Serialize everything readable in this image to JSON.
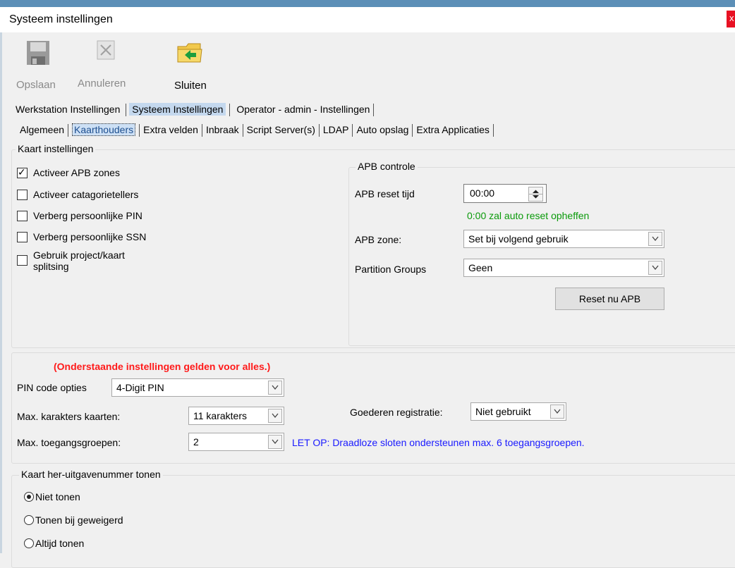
{
  "window": {
    "title": "Systeem instellingen",
    "close_glyph": "x"
  },
  "toolbar": {
    "save": {
      "label": "Opslaan",
      "icon": "save-icon"
    },
    "cancel": {
      "label": "Annuleren",
      "icon": "cancel-icon"
    },
    "close": {
      "label": "Sluiten",
      "icon": "folder-exit-icon"
    }
  },
  "main_tabs": [
    "Werkstation Instellingen",
    "Systeem Instellingen",
    "Operator - admin - Instellingen"
  ],
  "sub_tabs": [
    "Algemeen",
    "Kaarthouders",
    "Extra velden",
    "Inbraak",
    "Script Server(s)",
    "LDAP",
    "Auto opslag",
    "Extra Applicaties"
  ],
  "card_settings": {
    "legend": "Kaart instellingen",
    "checkboxes": [
      {
        "label": "Activeer APB zones",
        "checked": true
      },
      {
        "label": "Activeer catagorietellers",
        "checked": false
      },
      {
        "label": "Verberg persoonlijke PIN",
        "checked": false
      },
      {
        "label": "Verberg persoonlijke SSN",
        "checked": false
      },
      {
        "label_line1": "Gebruik project/kaart",
        "label_line2": "splitsing",
        "checked": false
      }
    ]
  },
  "apb": {
    "legend": "APB controle",
    "reset_time_label": "APB reset tijd",
    "reset_time_value": "00:00",
    "reset_hint": "0:00 zal auto reset opheffen",
    "zone_label": "APB zone:",
    "zone_value": "Set bij volgend gebruik",
    "partition_label": "Partition Groups",
    "partition_value": "Geen",
    "reset_button": "Reset nu APB"
  },
  "global": {
    "warning": "(Onderstaande instellingen gelden voor alles.)",
    "pin_label": "PIN code opties",
    "pin_value": "4-Digit PIN",
    "max_chars_label": "Max. karakters kaarten:",
    "max_chars_value": "11 karakters",
    "goods_label": "Goederen registratie:",
    "goods_value": "Niet gebruikt",
    "max_groups_label": "Max. toegangsgroepen:",
    "max_groups_value": "2",
    "note": "LET OP: Draadloze sloten ondersteunen max. 6 toegangsgroepen."
  },
  "reissue": {
    "legend": "Kaart her-uitgavenummer tonen",
    "options": [
      {
        "label": "Niet tonen",
        "selected": true
      },
      {
        "label": "Tonen bij geweigerd",
        "selected": false
      },
      {
        "label": "Altijd tonen",
        "selected": false
      }
    ]
  },
  "colors": {
    "warning": "#ff1a1a",
    "hint": "#0a9a0a",
    "note": "#1a1aff",
    "tab_selected": "#c4d8ee"
  }
}
